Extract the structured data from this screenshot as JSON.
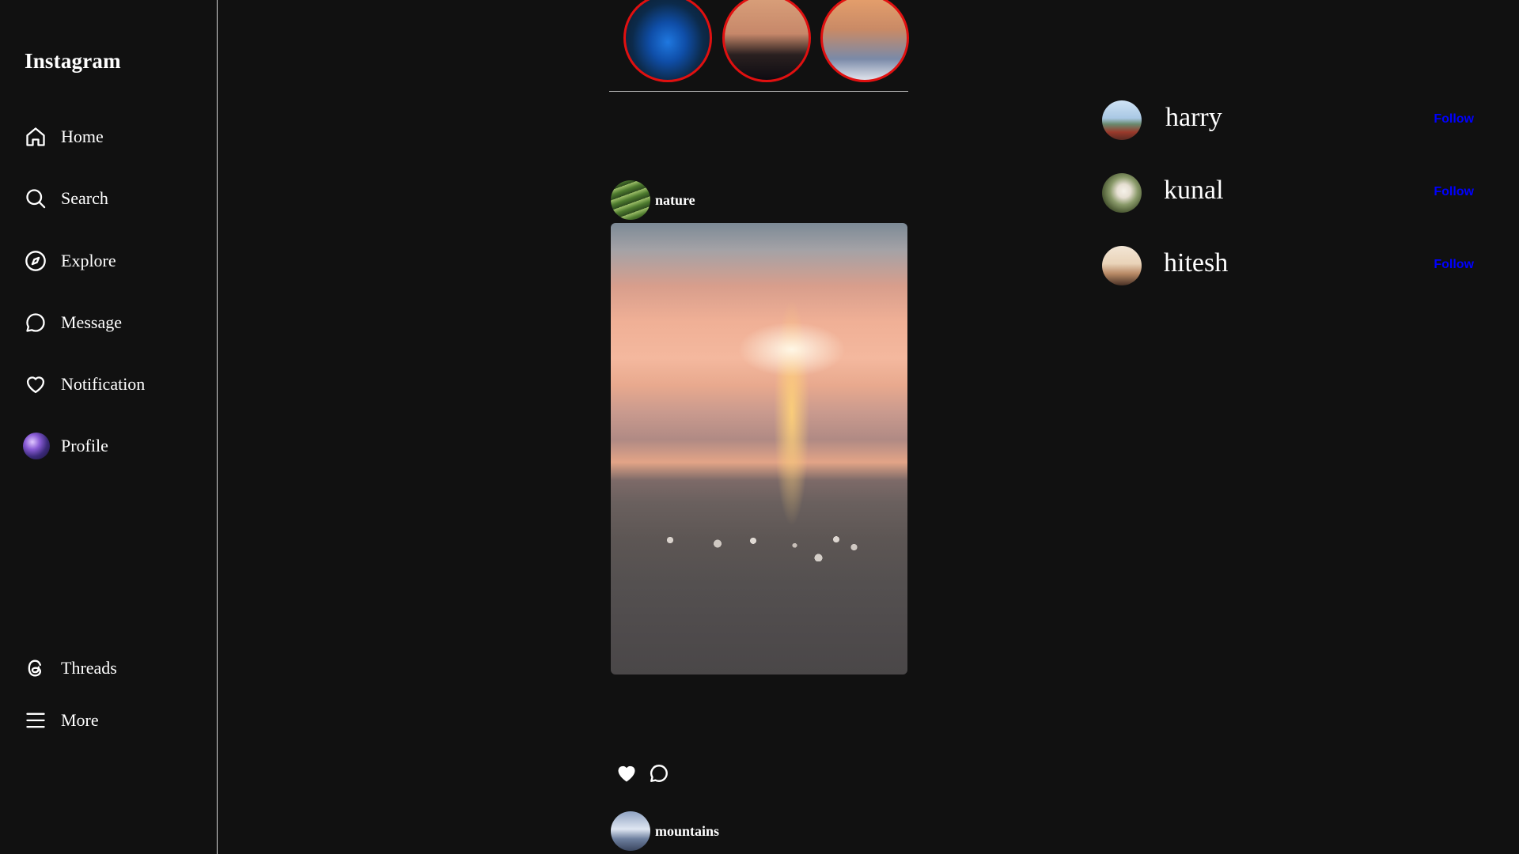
{
  "sidebar": {
    "brand": "Instagram",
    "items": [
      {
        "label": "Home",
        "icon": "home-icon"
      },
      {
        "label": "Search",
        "icon": "search-icon"
      },
      {
        "label": "Explore",
        "icon": "compass-icon"
      },
      {
        "label": "Message",
        "icon": "message-bubble-icon"
      },
      {
        "label": "Notification",
        "icon": "heart-icon"
      },
      {
        "label": "Profile",
        "icon": "profile-avatar"
      }
    ],
    "bottom_items": [
      {
        "label": "Threads",
        "icon": "threads-icon"
      },
      {
        "label": "More",
        "icon": "menu-icon"
      }
    ]
  },
  "stories": [
    {
      "name": "story-blue-waterfall"
    },
    {
      "name": "story-sunset-coast"
    },
    {
      "name": "story-sunset-clouds"
    }
  ],
  "feed": {
    "posts": [
      {
        "username": "nature"
      },
      {
        "username": "mountains"
      }
    ]
  },
  "suggestions": [
    {
      "name": "harry",
      "action": "Follow"
    },
    {
      "name": "kunal",
      "action": "Follow"
    },
    {
      "name": "hitesh",
      "action": "Follow"
    }
  ],
  "colors": {
    "background": "#111111",
    "story_ring": "#e01010",
    "follow_link": "#0000ff",
    "text": "#ffffff"
  }
}
